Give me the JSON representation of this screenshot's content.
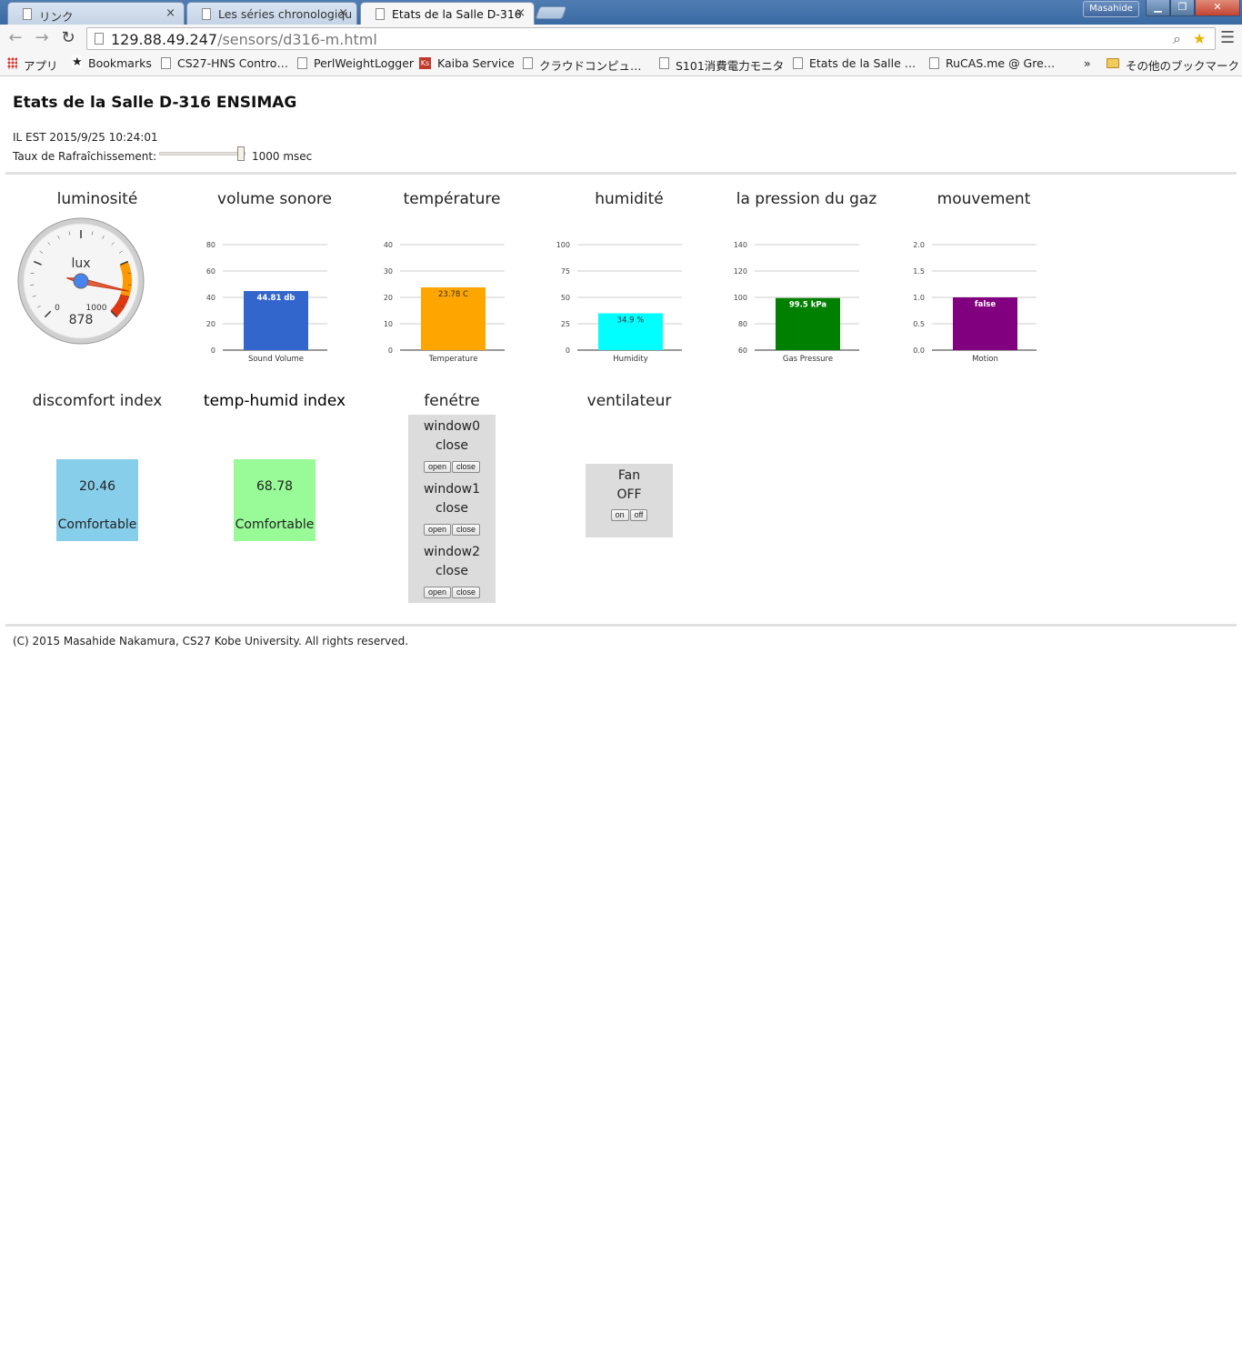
{
  "browser": {
    "tabs": [
      {
        "label": "リンク"
      },
      {
        "label": "Les séries chronologiqu"
      },
      {
        "label": "Etats de la Salle D-316"
      }
    ],
    "close_glyph": "×",
    "profile": "Masahide",
    "url_host": "129.88.49.247",
    "url_path": "/sensors/d316-m.html",
    "bookmarks": [
      {
        "label": "アプリ",
        "icon": "apps-grid-icon"
      },
      {
        "label": "Bookmarks",
        "icon": "star-icon"
      },
      {
        "label": "CS27-HNS Contro…",
        "icon": "page-icon"
      },
      {
        "label": "PerlWeightLogger",
        "icon": "page-icon"
      },
      {
        "label": "Kaiba Service",
        "icon": "ks-icon"
      },
      {
        "label": "クラウドコンピュ…",
        "icon": "page-icon"
      },
      {
        "label": "S101消費電力モニタ",
        "icon": "page-icon"
      },
      {
        "label": "Etats de la Salle …",
        "icon": "page-icon"
      },
      {
        "label": "RuCAS.me @ Gre…",
        "icon": "page-icon"
      }
    ],
    "bookmarks_overflow": "»",
    "other_bookmarks": "その他のブックマーク"
  },
  "page": {
    "title": "Etats de la Salle D-316 ENSIMAG",
    "clock": "IL EST 2015/9/25 10:24:01",
    "rate_label": "Taux de Rafraîchissement:",
    "rate_value": "1000 msec",
    "rate_fraction": 0.98,
    "footer": "(C) 2015 Masahide Nakamura, CS27 Kobe University. All rights reserved."
  },
  "panels": {
    "luminosite": "luminosité",
    "volume": "volume sonore",
    "temperature": "température",
    "humidite": "humidité",
    "pression": "la pression du gaz",
    "mouvement": "mouvement",
    "discomfort": "discomfort index",
    "temphumid": "temp-humid index",
    "fenetre": "fenétre",
    "ventilateur": "ventilateur"
  },
  "gauge": {
    "unit": "lux",
    "value": 878,
    "min": 0,
    "max": 1000,
    "min_label": "0",
    "max_label": "1000",
    "value_label": "878",
    "bands": [
      {
        "from": 750,
        "to": 900,
        "color": "#ff9900"
      },
      {
        "from": 900,
        "to": 1000,
        "color": "#dc3912"
      }
    ]
  },
  "chart_data": [
    {
      "type": "bar",
      "categories": [
        "Sound Volume"
      ],
      "values": [
        44.81
      ],
      "data_label": "44.81 db",
      "ylim": [
        0,
        80
      ],
      "yticks": [
        "0",
        "20",
        "40",
        "60",
        "80"
      ],
      "color": "#3366cc",
      "label_color": "#ffffff"
    },
    {
      "type": "bar",
      "categories": [
        "Temperature"
      ],
      "values": [
        23.78
      ],
      "data_label": "23.78 C",
      "ylim": [
        0,
        40
      ],
      "yticks": [
        "0",
        "10",
        "20",
        "30",
        "40"
      ],
      "color": "#ffa500",
      "label_color": "#333333"
    },
    {
      "type": "bar",
      "categories": [
        "Humidity"
      ],
      "values": [
        34.9
      ],
      "data_label": "34.9 %",
      "ylim": [
        0,
        100
      ],
      "yticks": [
        "0",
        "25",
        "50",
        "75",
        "100"
      ],
      "color": "#00ffff",
      "label_color": "#333333"
    },
    {
      "type": "bar",
      "categories": [
        "Gas Pressure"
      ],
      "values": [
        99.5
      ],
      "data_label": "99.5 kPa",
      "ylim": [
        60,
        140
      ],
      "yticks": [
        "60",
        "80",
        "100",
        "120",
        "140"
      ],
      "color": "#008000",
      "label_color": "#ffffff"
    },
    {
      "type": "bar",
      "categories": [
        "Motion"
      ],
      "values": [
        1.0
      ],
      "data_label": "false",
      "ylim": [
        0,
        2
      ],
      "yticks": [
        "0.0",
        "0.5",
        "1.0",
        "1.5",
        "2.0"
      ],
      "color": "#800080",
      "label_color": "#ffffff"
    }
  ],
  "indices": {
    "discomfort": {
      "value": "20.46",
      "status": "Comfortable",
      "color": "#87ceeb"
    },
    "temphumid": {
      "value": "68.78",
      "status": "Comfortable",
      "color": "#98fb98"
    }
  },
  "windows": [
    {
      "name": "window0",
      "state": "close"
    },
    {
      "name": "window1",
      "state": "close"
    },
    {
      "name": "window2",
      "state": "close"
    }
  ],
  "window_buttons": {
    "open": "open",
    "close": "close"
  },
  "fan": {
    "name": "Fan",
    "state": "OFF",
    "on": "on",
    "off": "off"
  }
}
